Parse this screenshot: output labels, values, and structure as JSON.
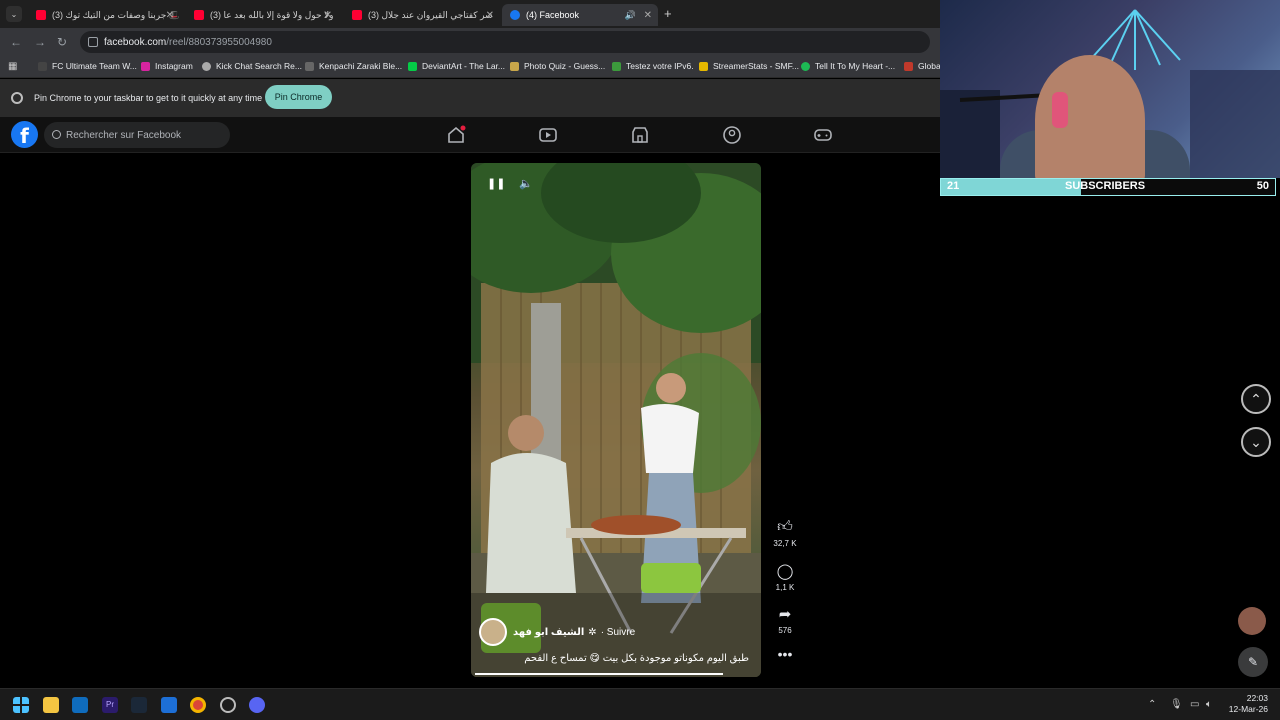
{
  "browser": {
    "tabs": [
      {
        "label": "(3) جربنا وصفات من التيك توك 🎩",
        "type": "yt"
      },
      {
        "label": "(3) ولا حول ولا قوة إلا بالله بعد عا",
        "type": "yt"
      },
      {
        "label": "(3) سر كفتاجي القيروان عند جلال",
        "type": "yt"
      },
      {
        "label": "(4) Facebook",
        "type": "fb"
      }
    ],
    "url_host": "facebook.com",
    "url_path": "/reel/880373955004980",
    "bookmarks": [
      "FC Ultimate Team W...",
      "Instagram",
      "Kick Chat Search Re...",
      "Kenpachi Zaraki Ble...",
      "DeviantArt - The Lar...",
      "Photo Quiz - Guess...",
      "Testez votre IPv6.",
      "StreamerStats - SMF...",
      "Tell It To My Heart -...",
      "Globa"
    ],
    "pin_text": "Pin Chrome to your taskbar to get to it quickly at any time",
    "pin_button": "Pin Chrome"
  },
  "facebook": {
    "search_placeholder": "Rechercher sur Facebook",
    "logo": "f",
    "reel": {
      "author": "الشيف ابو فهد",
      "follow": "· Suivre",
      "caption": "طبق اليوم مكوناتو موجودة بكل بيت 😋 تمساح ع الفحم"
    },
    "actions": {
      "likes": "32,7 K",
      "comments": "1,1 K",
      "shares": "576"
    }
  },
  "stream": {
    "sub_current": "21",
    "sub_label": "SUBSCRIBERS",
    "sub_goal": "50",
    "sub_progress": 0.42
  },
  "taskbar": {
    "time": "22:03",
    "date": "12-Mar-26"
  }
}
